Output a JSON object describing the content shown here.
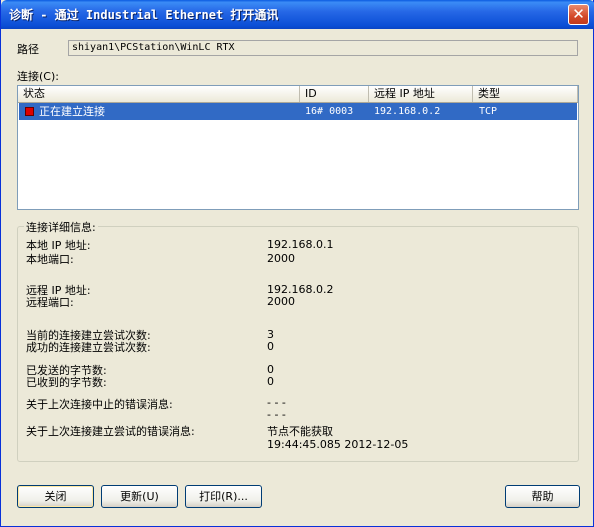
{
  "window": {
    "title": "诊断 - 通过 Industrial Ethernet 打开通讯",
    "close_glyph": "✕"
  },
  "path": {
    "label": "路径",
    "value": "shiyan1\\PCStation\\WinLC RTX"
  },
  "connections": {
    "label": "连接(C):",
    "columns": [
      "状态",
      "ID",
      "远程 IP 地址",
      "类型"
    ],
    "rows": [
      {
        "status": "正在建立连接",
        "status_color": "#e00000",
        "id": "16# 0003",
        "remote_ip": "192.168.0.2",
        "type": "TCP"
      }
    ]
  },
  "details": {
    "title": "连接详细信息:",
    "local_ip_label": "本地 IP 地址:",
    "local_ip": "192.168.0.1",
    "local_port_label": "本地端口:",
    "local_port": "2000",
    "remote_ip_label": "远程 IP 地址:",
    "remote_ip": "192.168.0.2",
    "remote_port_label": "远程端口:",
    "remote_port": "2000",
    "current_attempts_label": "当前的连接建立尝试次数:",
    "current_attempts": "3",
    "successful_attempts_label": "成功的连接建立尝试次数:",
    "successful_attempts": "0",
    "bytes_sent_label": "已发送的字节数:",
    "bytes_sent": "0",
    "bytes_received_label": "已收到的字节数:",
    "bytes_received": "0",
    "last_abort_error_label": "关于上次连接中止的错误消息:",
    "last_abort_error_line1": "- - -",
    "last_abort_error_line2": "- - -",
    "last_attempt_error_label": "关于上次连接建立尝试的错误消息:",
    "last_attempt_error": "节点不能获取",
    "last_attempt_time": "19:44:45.085  2012-12-05"
  },
  "buttons": {
    "close": "关闭",
    "refresh": "更新(U)",
    "print": "打印(R)...",
    "help": "帮助"
  },
  "colors": {
    "title_bar": "#0b4fd6",
    "selection": "#316ac5",
    "dialog_bg": "#ece9d8"
  }
}
